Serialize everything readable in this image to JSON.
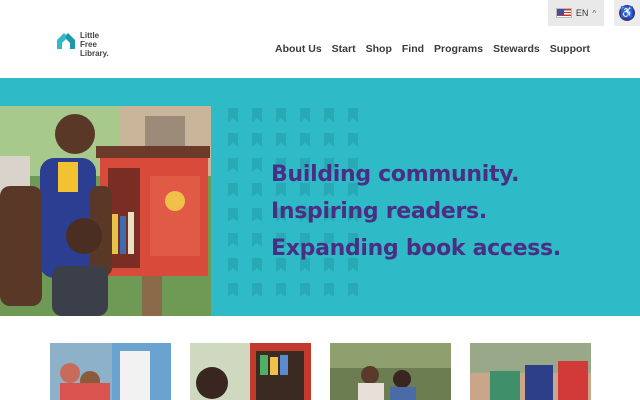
{
  "header": {
    "language": {
      "code": "EN",
      "flag_icon": "us-flag-icon"
    },
    "accessibility_icon": "accessibility-icon",
    "logo": {
      "lines": [
        "Little",
        "Free",
        "Library."
      ],
      "icon": "house-book-logo-icon"
    },
    "nav": [
      {
        "label": "About Us"
      },
      {
        "label": "Start"
      },
      {
        "label": "Shop"
      },
      {
        "label": "Find"
      },
      {
        "label": "Programs"
      },
      {
        "label": "Stewards"
      },
      {
        "label": "Support"
      }
    ]
  },
  "hero": {
    "lines": [
      "Building community.",
      "Inspiring readers.",
      "Expanding book access."
    ],
    "image": "man-and-child-at-little-free-library-photo"
  },
  "colors": {
    "teal": "#2ebac6",
    "purple": "#4b2e83"
  },
  "thumbnails": [
    {
      "image": "children-at-library-box-photo"
    },
    {
      "image": "girl-with-bookshelf-photo"
    },
    {
      "image": "women-outdoors-photo"
    },
    {
      "image": "colorful-library-box-photo"
    }
  ]
}
